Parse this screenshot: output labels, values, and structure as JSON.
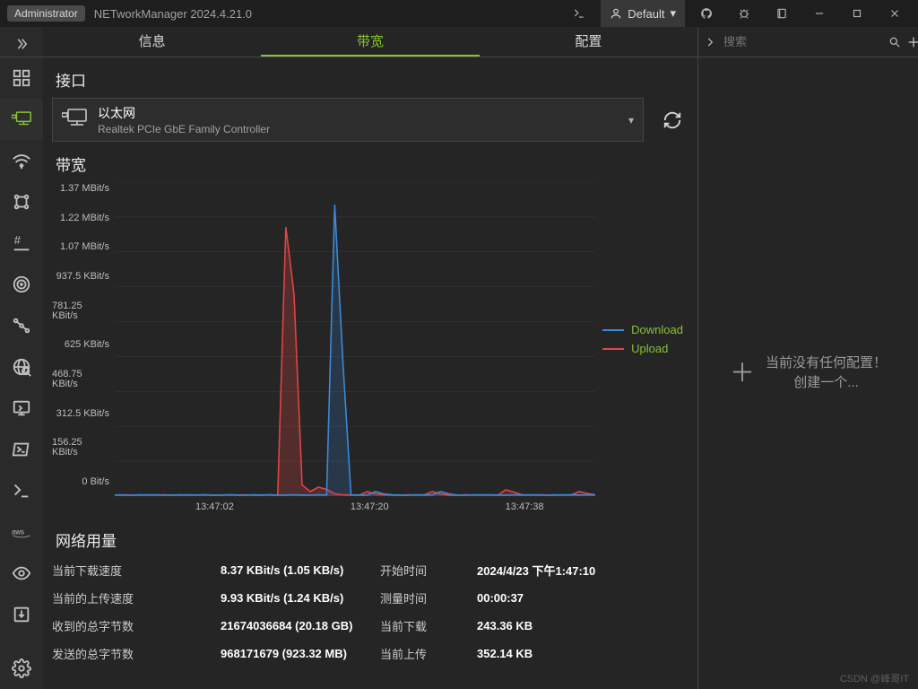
{
  "titlebar": {
    "admin_label": "Administrator",
    "app_title": "NETworkManager 2024.4.21.0",
    "profile_label": "Default"
  },
  "tabs": {
    "info": "信息",
    "bandwidth": "带宽",
    "config": "配置"
  },
  "sections": {
    "interface": "接口",
    "bandwidth": "带宽",
    "network_usage": "网络用量"
  },
  "interface": {
    "name": "以太网",
    "description": "Realtek PCIe GbE Family Controller"
  },
  "chart_data": {
    "type": "line",
    "xlabel": "",
    "ylabel": "",
    "ylim_kbps": [
      0,
      1400
    ],
    "y_ticks": [
      "1.37 MBit/s",
      "1.22 MBit/s",
      "1.07 MBit/s",
      "937.5 KBit/s",
      "781.25 KBit/s",
      "625 KBit/s",
      "468.75 KBit/s",
      "312.5 KBit/s",
      "156.25 KBit/s",
      "0 Bit/s"
    ],
    "x_ticks": [
      "13:47:02",
      "13:47:20",
      "13:47:38"
    ],
    "series": [
      {
        "name": "Download",
        "color": "#3b89d9",
        "x": [
          0,
          1,
          2,
          3,
          4,
          5,
          6,
          7,
          8,
          9,
          10,
          11,
          12,
          13,
          14,
          15,
          16,
          17,
          18,
          19,
          20,
          21,
          22,
          23,
          24,
          25,
          26,
          27,
          28,
          29,
          30,
          31,
          32,
          33,
          34,
          35,
          36,
          37,
          38,
          39,
          40,
          41,
          42,
          43,
          44,
          45,
          46,
          47,
          48,
          49,
          50,
          51,
          52,
          53,
          54,
          55,
          56,
          57,
          58,
          59
        ],
        "y_kbps": [
          5,
          5,
          4,
          6,
          5,
          6,
          4,
          5,
          6,
          5,
          5,
          6,
          4,
          5,
          6,
          5,
          4,
          6,
          5,
          6,
          4,
          5,
          6,
          5,
          4,
          6,
          5,
          1300,
          600,
          6,
          5,
          4,
          20,
          10,
          6,
          5,
          4,
          6,
          5,
          6,
          20,
          10,
          5,
          4,
          6,
          5,
          6,
          5,
          4,
          6,
          5,
          6,
          5,
          4,
          6,
          5,
          6,
          5,
          6,
          5
        ]
      },
      {
        "name": "Upload",
        "color": "#e14444",
        "x": [
          0,
          1,
          2,
          3,
          4,
          5,
          6,
          7,
          8,
          9,
          10,
          11,
          12,
          13,
          14,
          15,
          16,
          17,
          18,
          19,
          20,
          21,
          22,
          23,
          24,
          25,
          26,
          27,
          28,
          29,
          30,
          31,
          32,
          33,
          34,
          35,
          36,
          37,
          38,
          39,
          40,
          41,
          42,
          43,
          44,
          45,
          46,
          47,
          48,
          49,
          50,
          51,
          52,
          53,
          54,
          55,
          56,
          57,
          58,
          59
        ],
        "y_kbps": [
          5,
          6,
          5,
          4,
          6,
          5,
          6,
          5,
          4,
          6,
          5,
          6,
          5,
          4,
          6,
          5,
          6,
          5,
          4,
          6,
          5,
          1200,
          900,
          50,
          20,
          40,
          30,
          10,
          6,
          5,
          4,
          20,
          10,
          6,
          5,
          4,
          6,
          5,
          6,
          20,
          10,
          5,
          4,
          6,
          5,
          6,
          5,
          4,
          28,
          18,
          6,
          5,
          6,
          5,
          4,
          6,
          5,
          20,
          12,
          6
        ]
      }
    ],
    "legend": {
      "download": "Download",
      "upload": "Upload"
    }
  },
  "stats": {
    "labels": {
      "current_download": "当前下载速度",
      "current_upload": "当前的上传速度",
      "bytes_received": "收到的总字节数",
      "bytes_sent": "发送的总字节数",
      "start_time": "开始时间",
      "measure_time": "测量时间",
      "current_dl": "当前下载",
      "current_ul": "当前上传"
    },
    "values": {
      "current_download": "8.37 KBit/s (1.05 KB/s)",
      "current_upload": "9.93 KBit/s (1.24 KB/s)",
      "bytes_received": "21674036684 (20.18 GB)",
      "bytes_sent": "968171679 (923.32 MB)",
      "start_time": "2024/4/23 下午1:47:10",
      "measure_time": "00:00:37",
      "current_dl": "243.36 KB",
      "current_ul": "352.14 KB"
    }
  },
  "right": {
    "search_placeholder": "搜索",
    "empty_line1": "当前没有任何配置！",
    "empty_line2": "创建一个..."
  },
  "watermark": "CSDN @峰哥IT"
}
